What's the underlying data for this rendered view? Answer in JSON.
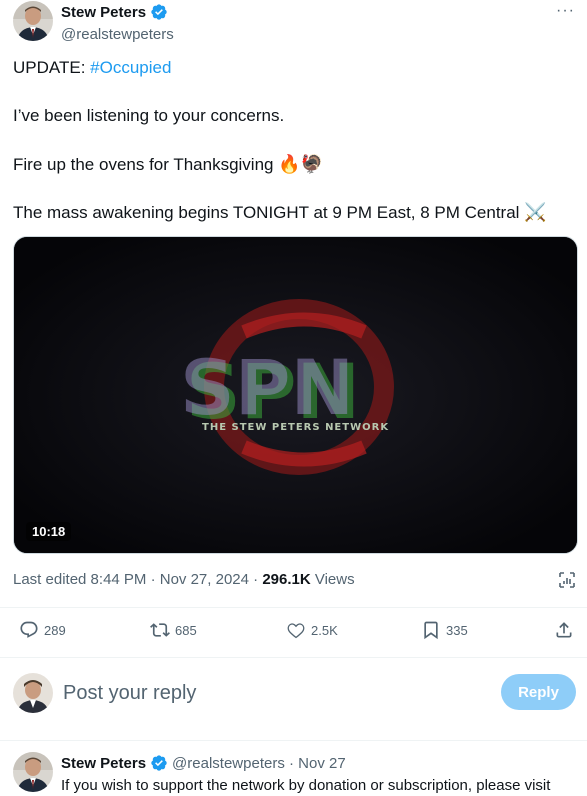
{
  "author": {
    "name": "Stew Peters",
    "handle": "@realstewpeters"
  },
  "tweet": {
    "line1_prefix": "UPDATE: ",
    "line1_hashtag": "#Occupied",
    "line2": "I’ve been listening to your concerns.",
    "line3": "Fire up the ovens for Thanksgiving",
    "line3_emoji": "🔥🦃",
    "line4": "The mass awakening begins TONIGHT at 9 PM East, 8 PM Central",
    "line4_emoji": "⚔️"
  },
  "video": {
    "duration": "10:18",
    "logo_text": "SPN",
    "logo_subtext": "THE STEW PETERS NETWORK"
  },
  "meta": {
    "edited": "Last edited 8:44 PM · Nov 27, 2024 · ",
    "views_count": "296.1K",
    "views_label": " Views"
  },
  "actions": {
    "replies": "289",
    "reposts": "685",
    "likes": "2.5K",
    "bookmarks": "335"
  },
  "reply_box": {
    "placeholder": "Post your reply",
    "button": "Reply"
  },
  "reply_tweet": {
    "name": "Stew Peters",
    "handle_date": "@realstewpeters · Nov 27",
    "text": "If you wish to support the network by donation or subscription, please visit"
  },
  "colors": {
    "accent": "#1d9bf0",
    "reply_button": "#8ecdf8",
    "secondary_text": "#536471"
  }
}
